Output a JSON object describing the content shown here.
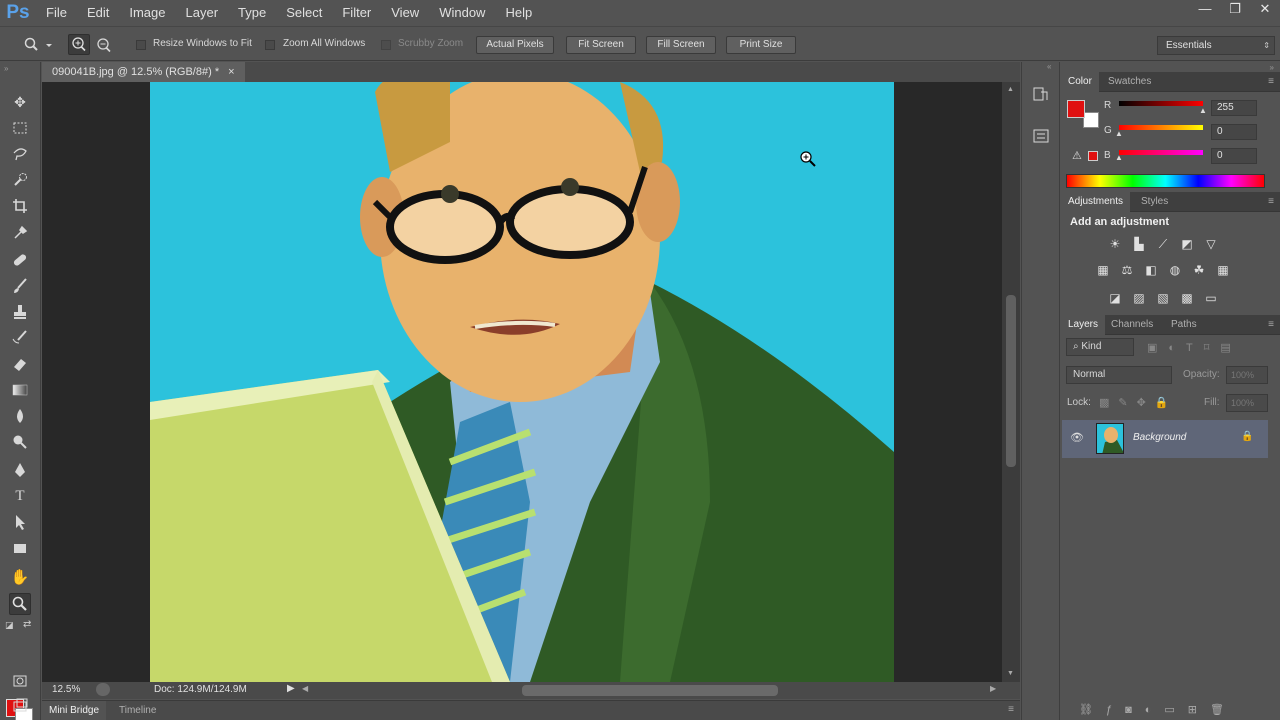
{
  "app": {
    "logo": "Ps"
  },
  "menu": [
    "File",
    "Edit",
    "Image",
    "Layer",
    "Type",
    "Select",
    "Filter",
    "View",
    "Window",
    "Help"
  ],
  "window_controls": {
    "minimize": "—",
    "restore": "❐",
    "close": "✕"
  },
  "options": {
    "resize_windows": "Resize Windows to Fit",
    "zoom_all": "Zoom All Windows",
    "scrubby": "Scrubby Zoom",
    "actual_pixels": "Actual Pixels",
    "fit_screen": "Fit Screen",
    "fill_screen": "Fill Screen",
    "print_size": "Print Size",
    "workspace": "Essentials"
  },
  "document": {
    "tab_title": "090041B.jpg @ 12.5% (RGB/8#) *",
    "close": "×",
    "zoom": "12.5%",
    "doc_info": "Doc: 124.9M/124.9M"
  },
  "bottom_tabs": [
    "Mini Bridge",
    "Timeline"
  ],
  "color_panel": {
    "tabs": [
      "Color",
      "Swatches"
    ],
    "channels": [
      {
        "label": "R",
        "value": "255"
      },
      {
        "label": "G",
        "value": "0"
      },
      {
        "label": "B",
        "value": "0"
      }
    ],
    "fg_color": "#e01010",
    "bg_color": "#ffffff"
  },
  "adjust_panel": {
    "tabs": [
      "Adjustments",
      "Styles"
    ],
    "heading": "Add an adjustment"
  },
  "layers_panel": {
    "tabs": [
      "Layers",
      "Channels",
      "Paths"
    ],
    "filter_kind": "Kind",
    "blend_mode": "Normal",
    "opacity_label": "Opacity:",
    "opacity_value": "100%",
    "lock_label": "Lock:",
    "fill_label": "Fill:",
    "fill_value": "100%",
    "layers": [
      {
        "name": "Background",
        "locked": true,
        "visible": true
      }
    ]
  }
}
